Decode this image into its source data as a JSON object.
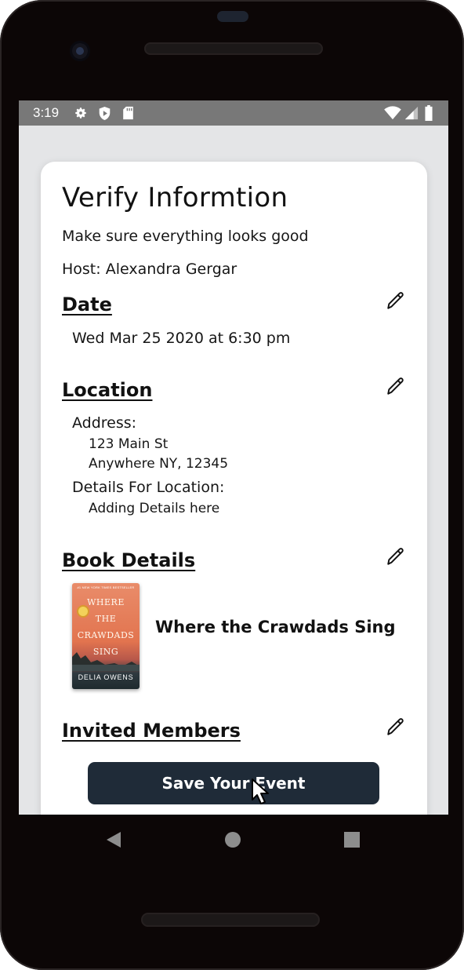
{
  "status_bar": {
    "time": "3:19",
    "icons": [
      "gear-icon",
      "shield-icon",
      "sd-card-icon",
      "wifi-icon",
      "signal-icon",
      "battery-icon"
    ]
  },
  "page": {
    "title": "Verify Informtion",
    "subtitle": "Make sure everything looks good",
    "host": "Host: Alexandra Gergar"
  },
  "date_section": {
    "heading": "Date",
    "value": "Wed Mar 25 2020 at 6:30 pm"
  },
  "location_section": {
    "heading": "Location",
    "address_label": "Address:",
    "address_line1": "123 Main St",
    "address_line2": "Anywhere NY, 12345",
    "details_label": "Details For Location:",
    "details_value": "Adding Details here"
  },
  "book_section": {
    "heading": "Book Details",
    "book_title": "Where the Crawdads Sing",
    "cover_banner": "#1 NEW YORK TIMES BESTSELLER",
    "cover_title": "WHERE\nTHE\nCRAWDADS\nSING",
    "cover_author": "DELIA OWENS"
  },
  "members_section": {
    "heading": "Invited Members"
  },
  "save_button": {
    "label": "Save Your Event"
  },
  "colors": {
    "accent": "#1f2b38",
    "screen_bg": "#e4e5e7",
    "status_bar": "#787878",
    "card": "#ffffff"
  },
  "nav": {
    "icons": [
      "back-icon",
      "home-icon",
      "recents-icon"
    ]
  }
}
